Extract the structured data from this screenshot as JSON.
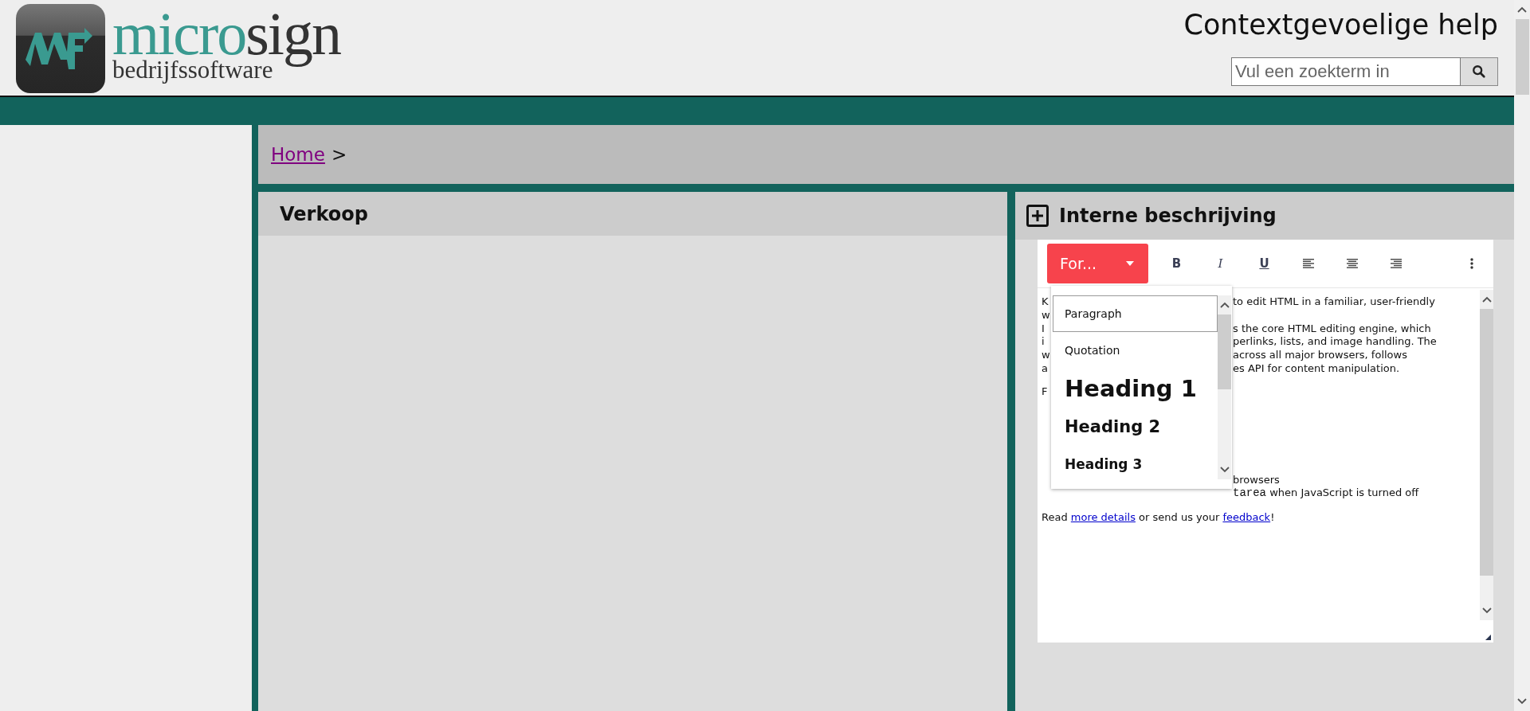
{
  "header": {
    "logo": {
      "brand_lead": "micro",
      "brand_tail": "sign",
      "tagline": "bedrijfssoftware"
    },
    "title": "Contextgevoelige help",
    "search": {
      "placeholder": "Vul een zoekterm in"
    }
  },
  "breadcrumb": {
    "link": "Home",
    "separator": ">"
  },
  "left_panel": {
    "title": "Verkoop"
  },
  "right_panel": {
    "title": "Interne beschrijving",
    "expanded": false,
    "editor": {
      "format_menu": {
        "label": "For...",
        "expanded": true,
        "options": [
          {
            "kind": "paragraph",
            "label": "Paragraph",
            "selected": true
          },
          {
            "kind": "quote",
            "label": "Quotation",
            "selected": false
          },
          {
            "kind": "h1",
            "label": "Heading 1",
            "selected": false
          },
          {
            "kind": "h2",
            "label": "Heading 2",
            "selected": false
          },
          {
            "kind": "h3",
            "label": "Heading 3",
            "selected": false
          }
        ]
      },
      "tools": [
        {
          "kind": "bold",
          "label": "B"
        },
        {
          "kind": "italic",
          "label": "I"
        },
        {
          "kind": "underline",
          "label": "U"
        },
        {
          "kind": "align-left"
        },
        {
          "kind": "align-center"
        },
        {
          "kind": "align-right"
        }
      ],
      "content": [
        {
          "kind": "paragraph",
          "lines": [
            {
              "left": "K",
              "right": "to edit HTML in a familiar, user-friendly"
            },
            {
              "left": "w"
            },
            {
              "left": "I",
              "right": "s the core HTML editing engine, which"
            },
            {
              "left": "i",
              "right": "perlinks, lists, and image handling. The"
            },
            {
              "left": "w",
              "right": "across all major browsers, follows"
            },
            {
              "left": "a",
              "right": "es API for content manipulation."
            }
          ]
        },
        {
          "kind": "paragraph",
          "lines": [
            {
              "left": "F"
            }
          ]
        },
        {
          "kind": "list",
          "lines": [
            {
              "right": "browsers"
            },
            {
              "code": "tarea",
              "right": "when JavaScript is turned off"
            }
          ]
        },
        {
          "kind": "links",
          "segments": [
            {
              "kind": "text",
              "text": "Read"
            },
            {
              "kind": "link",
              "text": "more details"
            },
            {
              "kind": "text",
              "text": "or send us your"
            },
            {
              "kind": "link",
              "text": "feedback"
            },
            {
              "kind": "text",
              "text": "!"
            }
          ]
        }
      ]
    }
  }
}
